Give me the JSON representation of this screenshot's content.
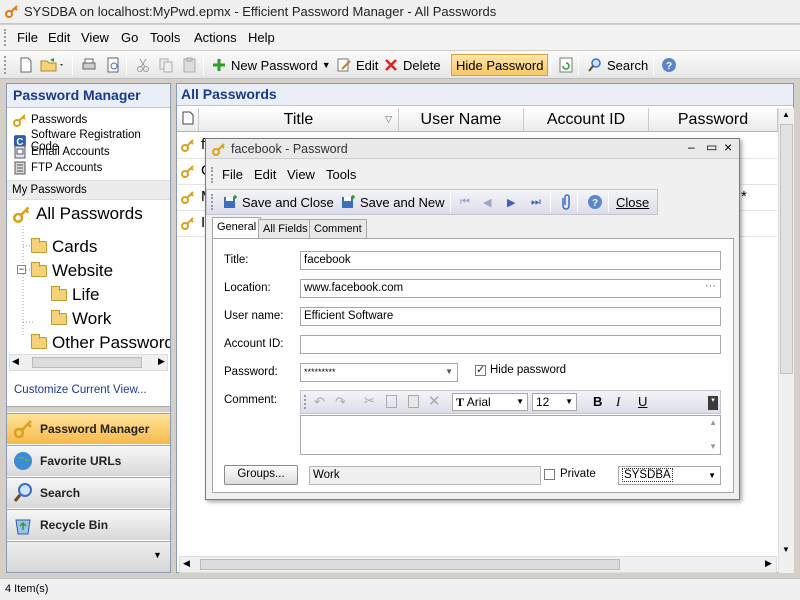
{
  "window": {
    "title": "SYSDBA on localhost:MyPwd.epmx - Efficient Password Manager - All Passwords"
  },
  "menubar": [
    "File",
    "Edit",
    "View",
    "Go",
    "Tools",
    "Actions",
    "Help"
  ],
  "toolbar": {
    "new_password": "New Password",
    "edit": "Edit",
    "delete": "Delete",
    "hide_password": "Hide Password",
    "search": "Search"
  },
  "left": {
    "header": "Password Manager",
    "categories": [
      "Passwords",
      "Software Registration Code",
      "Email Accounts",
      "FTP Accounts"
    ],
    "my_passwords": "My Passwords",
    "all_passwords": "All Passwords",
    "tree": [
      "Cards",
      "Website",
      "Life",
      "Work",
      "Other Passwords"
    ],
    "customize": "Customize Current View...",
    "nav": [
      "Password Manager",
      "Favorite URLs",
      "Search",
      "Recycle Bin"
    ]
  },
  "grid": {
    "header": "All Passwords",
    "columns": [
      "Title",
      "User Name",
      "Account ID",
      "Password"
    ],
    "rows": [
      {
        "title_start": "f",
        "pw_end": ""
      },
      {
        "title_start": "G",
        "pw_end": ""
      },
      {
        "title_start": "M",
        "pw_end": "*"
      },
      {
        "title_start": "I",
        "pw_end": ""
      }
    ]
  },
  "status": "4 Item(s)",
  "dialog": {
    "title": "facebook - Password",
    "menu": [
      "File",
      "Edit",
      "View",
      "Tools"
    ],
    "save_close": "Save and Close",
    "save_new": "Save and New",
    "close": "Close",
    "tabs": [
      "General",
      "All Fields",
      "Comment"
    ],
    "labels": {
      "title": "Title:",
      "location": "Location:",
      "user_name": "User name:",
      "account_id": "Account ID:",
      "password": "Password:",
      "comment": "Comment:"
    },
    "values": {
      "title": "facebook",
      "location": "www.facebook.com",
      "user_name": "Efficient Software",
      "account_id": "",
      "password": "*********"
    },
    "hide_password": "Hide password",
    "font": "Arial",
    "font_size": "12",
    "groups_button": "Groups...",
    "group_value": "Work",
    "private": "Private",
    "owner": "SYSDBA"
  }
}
